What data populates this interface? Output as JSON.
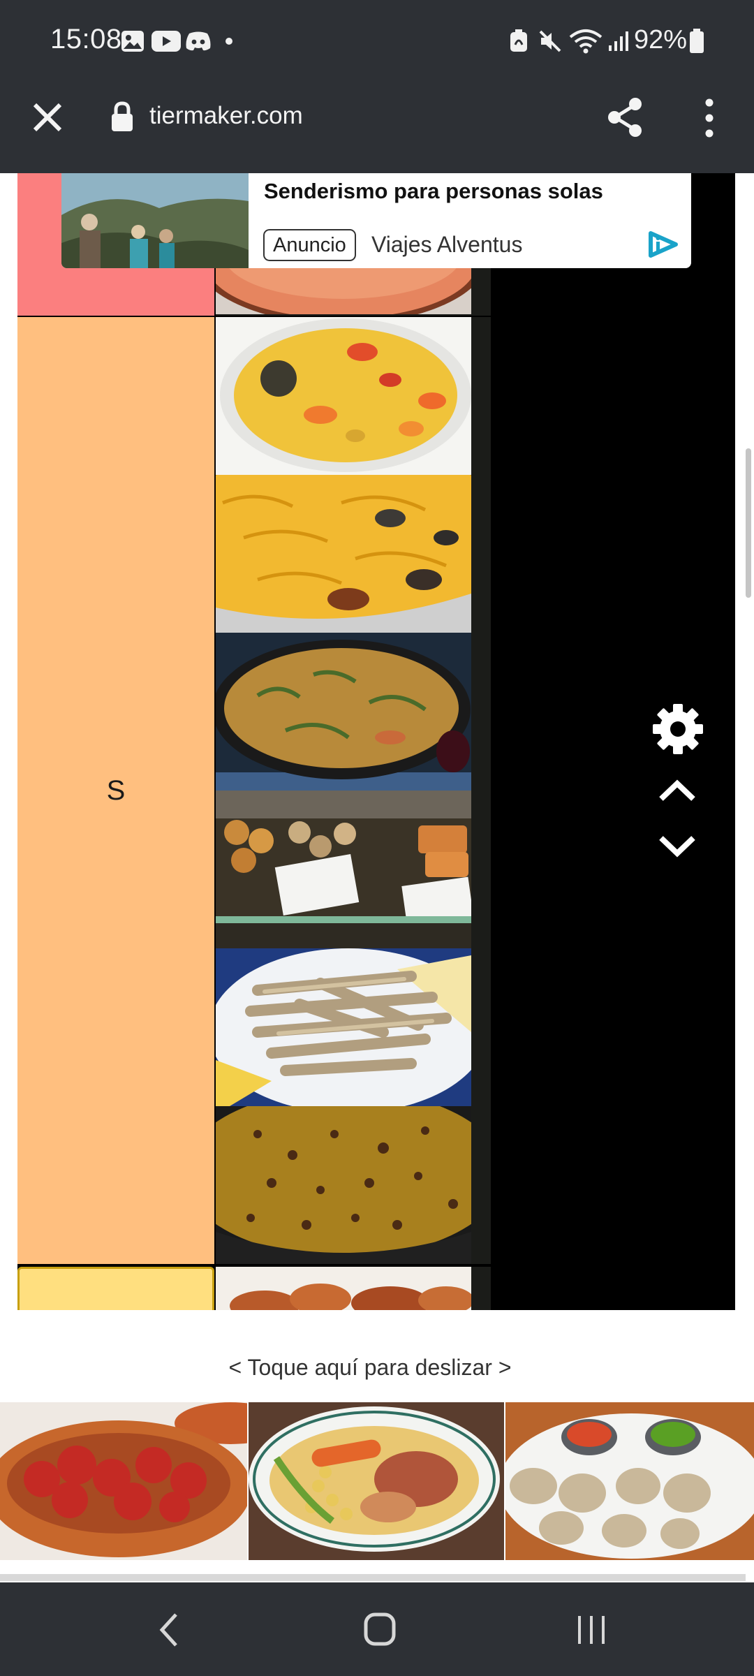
{
  "status_bar": {
    "time": "15:08",
    "battery": "92%",
    "left_icons": [
      "gallery-icon",
      "youtube-icon",
      "discord-icon",
      "dot-icon"
    ],
    "right_icons": [
      "battery-saver-icon",
      "mute-icon",
      "wifi-icon",
      "signal-icon",
      "battery-icon"
    ]
  },
  "browser": {
    "url": "tiermaker.com",
    "close_icon": "close-icon",
    "lock_icon": "lock-icon",
    "share_icon": "share-icon",
    "menu_icon": "more-vert-icon"
  },
  "ad": {
    "title": "Senderismo para personas solas",
    "badge": "Anuncio",
    "advertiser": "Viajes Alventus",
    "icon": "ad-choices-icon"
  },
  "tiers": [
    {
      "label": "",
      "color": "#fb7f7f",
      "items": [
        "tomato-soup"
      ]
    },
    {
      "label": "S",
      "color": "#ffbf7f",
      "items": [
        "arroz-caldoso",
        "fideua",
        "paella-verduras",
        "croquetas-vitrina",
        "boquerones-fritos",
        "arroz-negro-ahumado"
      ]
    },
    {
      "label": "",
      "color": "#ffdf7f",
      "items": [
        "fried-bites"
      ]
    }
  ],
  "tier_controls": {
    "settings_icon": "gear-icon",
    "up_icon": "chevron-up-icon",
    "down_icon": "chevron-down-icon"
  },
  "swipe_hint": "< Toque aquí para deslizar >",
  "tray_items": [
    "chorizo-al-vino",
    "cocido-madrileno",
    "papas-arrugadas"
  ],
  "nav": {
    "back_icon": "back-icon",
    "home_icon": "home-icon",
    "recents_icon": "recents-icon"
  },
  "colors": {
    "chrome": "#2d3035",
    "tier_items_bg": "#1b1c19",
    "page_bg": "#ffffff"
  }
}
